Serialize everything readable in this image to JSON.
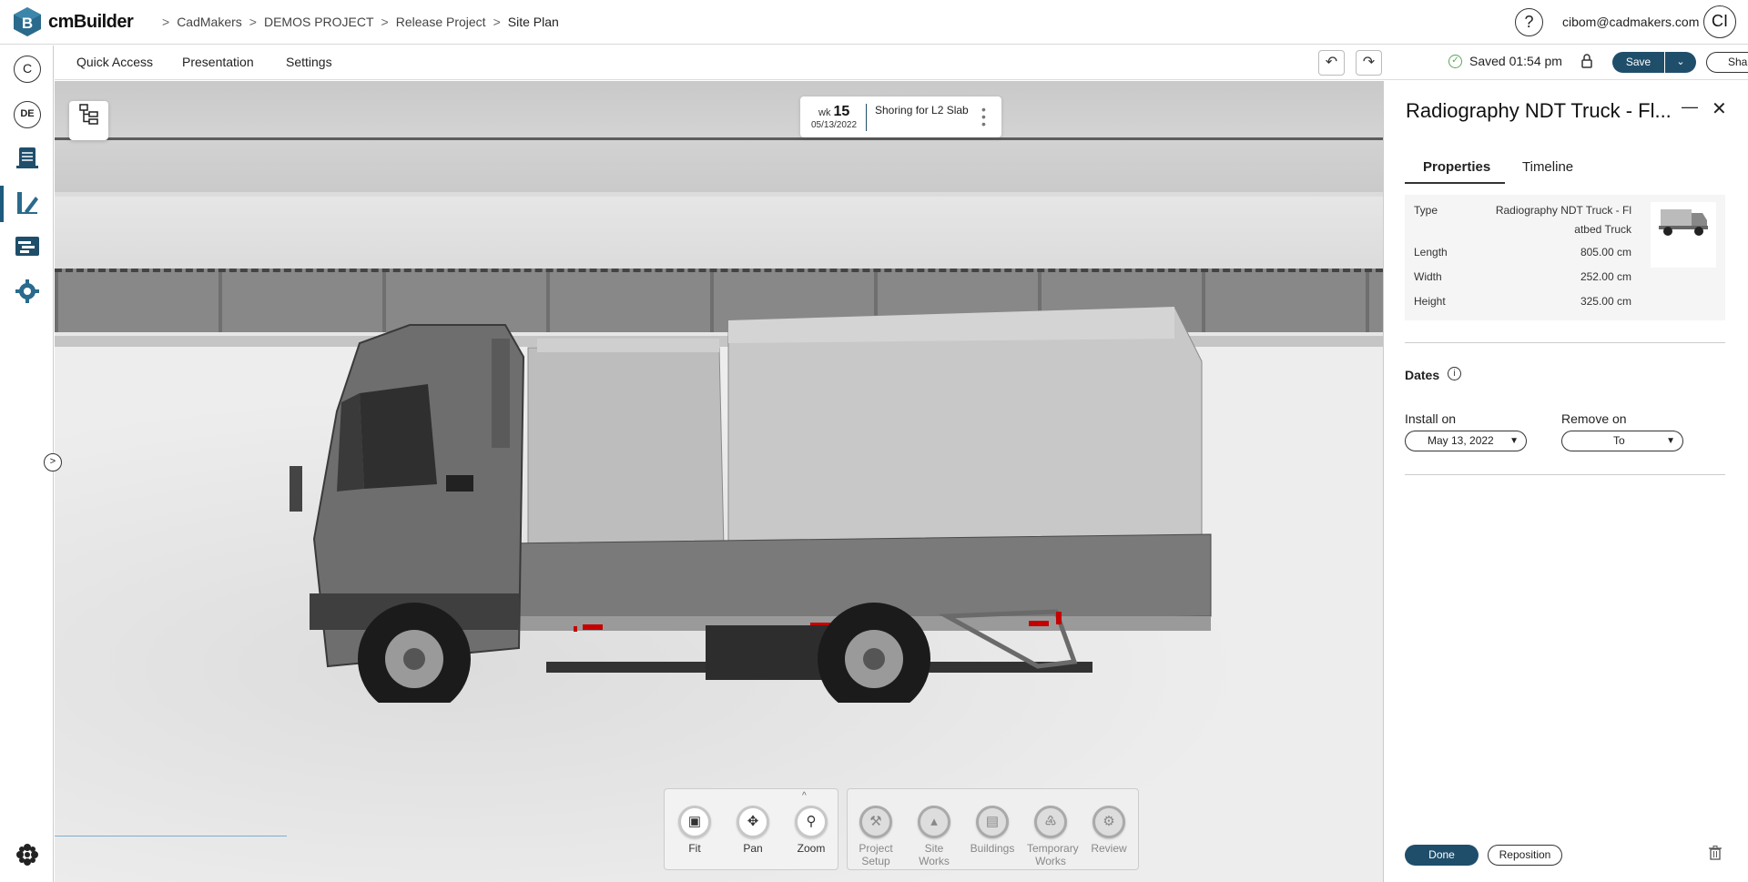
{
  "app": {
    "brand": "cmBuilder",
    "logo_letter": "B"
  },
  "breadcrumb": [
    "CadMakers",
    "DEMOS PROJECT",
    "Release Project",
    "Site Plan"
  ],
  "header": {
    "help_label": "?",
    "user_email": "cibom@cadmakers.com",
    "avatar_initials": "CI"
  },
  "leftbar": {
    "items": [
      {
        "icon": "company-c-icon",
        "label": "C"
      },
      {
        "icon": "project-de-icon",
        "label": "DE"
      },
      {
        "icon": "documents-icon"
      },
      {
        "icon": "design-pencil-icon",
        "active": true
      },
      {
        "icon": "schedule-icon"
      },
      {
        "icon": "settings-gear-icon"
      },
      {
        "icon": "apps-flower-icon"
      }
    ]
  },
  "menubar": {
    "items": [
      "Quick Access",
      "Presentation",
      "Settings"
    ],
    "saved_text": "Saved 01:54 pm",
    "save_label": "Save",
    "share_label": "Share"
  },
  "schedule": {
    "wk_prefix": "wk",
    "week": "15",
    "date": "05/13/2022",
    "task": "Shoring for L2 Slab"
  },
  "toolbar": {
    "view_tools": [
      {
        "icon": "fit-icon",
        "label": "Fit"
      },
      {
        "icon": "pan-icon",
        "label": "Pan"
      },
      {
        "icon": "zoom-icon",
        "label": "Zoom"
      }
    ],
    "category_tools": [
      {
        "icon": "project-setup-icon",
        "label": "Project Setup"
      },
      {
        "icon": "site-works-icon",
        "label": "Site Works"
      },
      {
        "icon": "buildings-icon",
        "label": "Buildings"
      },
      {
        "icon": "temporary-works-icon",
        "label": "Temporary Works"
      },
      {
        "icon": "review-icon",
        "label": "Review"
      }
    ]
  },
  "panel": {
    "title": "Radiography NDT Truck - Fl...",
    "tabs": [
      {
        "label": "Properties",
        "active": true
      },
      {
        "label": "Timeline",
        "active": false
      }
    ],
    "properties": {
      "type_label": "Type",
      "type_value_line1": "Radiography NDT Truck - Fl",
      "type_value_line2": "atbed Truck",
      "length_label": "Length",
      "length_value": "805.00 cm",
      "width_label": "Width",
      "width_value": "252.00 cm",
      "height_label": "Height",
      "height_value": "325.00 cm"
    },
    "dates": {
      "heading": "Dates",
      "install_label": "Install on",
      "install_value": "May 13, 2022",
      "remove_label": "Remove on",
      "remove_value": "To"
    },
    "done_label": "Done",
    "reposition_label": "Reposition"
  },
  "colors": {
    "primary": "#1f4e6b",
    "saved_check": "#5aa65a"
  }
}
